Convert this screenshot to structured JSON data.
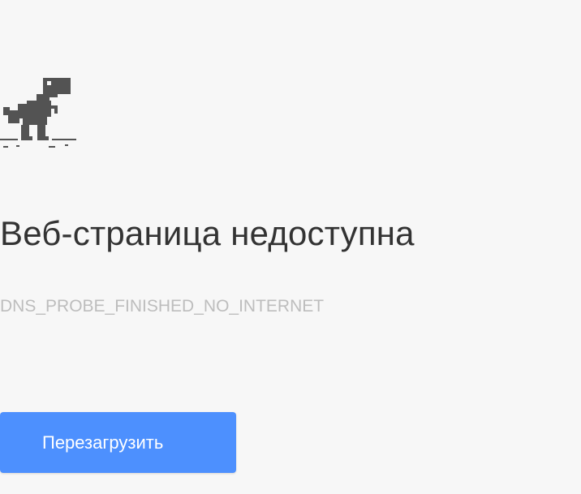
{
  "error_page": {
    "icon": "offline-dino-icon",
    "heading": "Веб-страница недоступна",
    "error_code": "DNS_PROBE_FINISHED_NO_INTERNET",
    "reload_label": "Перезагрузить"
  },
  "colors": {
    "background": "#f7f7f7",
    "heading": "#333333",
    "error_code": "#bdbdbd",
    "button": "#4d90fe",
    "dino": "#535353"
  }
}
